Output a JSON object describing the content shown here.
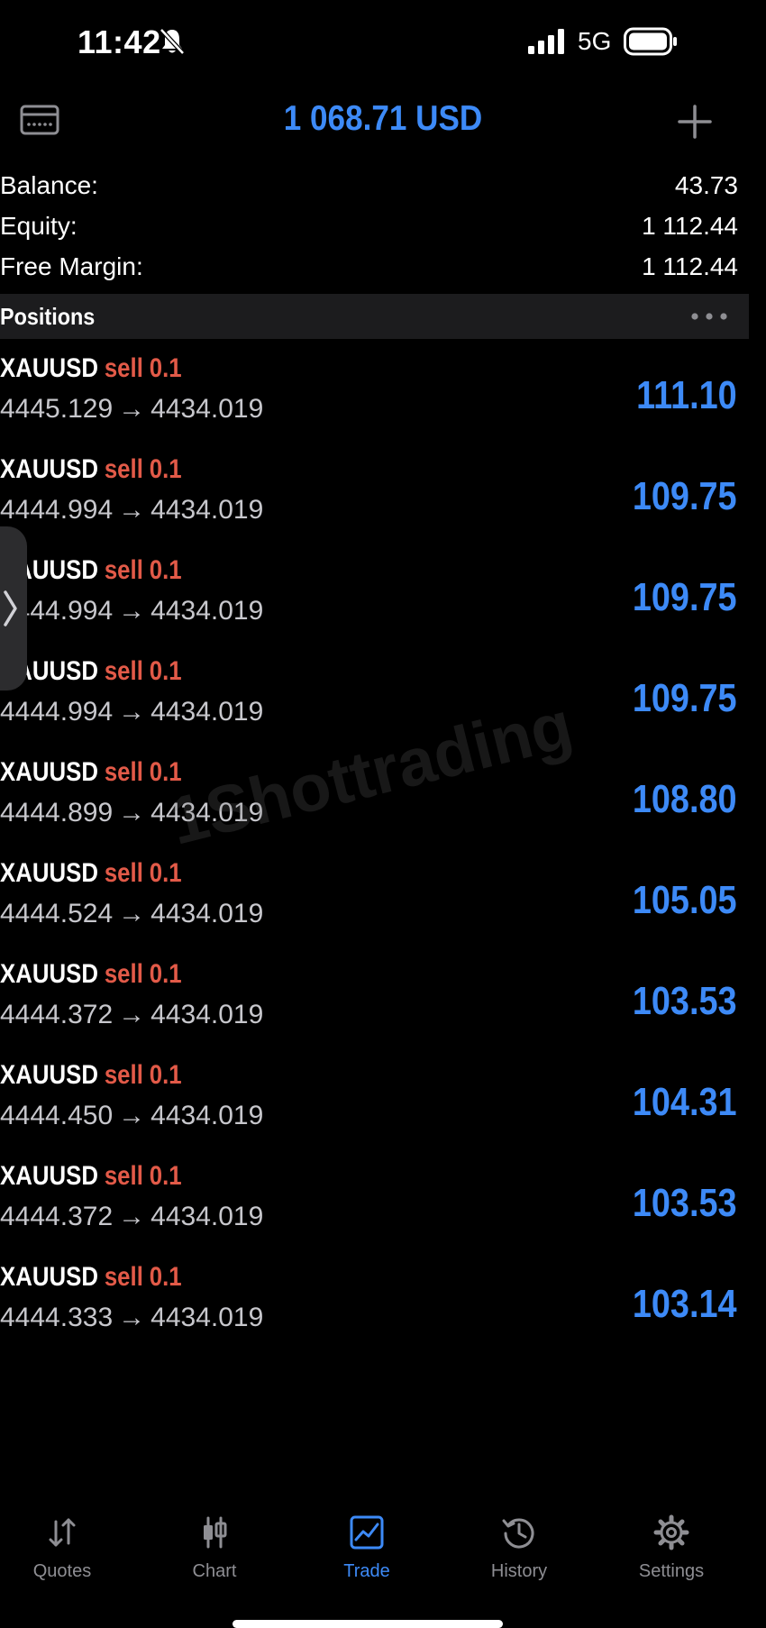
{
  "status_bar": {
    "time": "11:42",
    "network": "5G",
    "icons": [
      "bell-slash-icon",
      "signal-icon",
      "battery-icon"
    ]
  },
  "header": {
    "title": "1 068.71 USD",
    "left_icon": "wallet-icon",
    "right_icon": "plus-icon",
    "accent_color": "#3d8af7"
  },
  "summary": {
    "balance_label": "Balance:",
    "balance_value": "43.73",
    "equity_label": "Equity:",
    "equity_value": "1 112.44",
    "free_margin_label": "Free Margin:",
    "free_margin_value": "1 112.44"
  },
  "positions_section": {
    "title": "Positions",
    "menu_icon": "more-horizontal-icon"
  },
  "positions": [
    {
      "symbol": "XAUUSD",
      "side": "sell",
      "volume": "0.1",
      "open_price": "4445.129",
      "arrow": "→",
      "current_price": "4434.019",
      "profit": "111.10"
    },
    {
      "symbol": "XAUUSD",
      "side": "sell",
      "volume": "0.1",
      "open_price": "4444.994",
      "arrow": "→",
      "current_price": "4434.019",
      "profit": "109.75"
    },
    {
      "symbol": "XAUUSD",
      "side": "sell",
      "volume": "0.1",
      "open_price": "4444.994",
      "arrow": "→",
      "current_price": "4434.019",
      "profit": "109.75"
    },
    {
      "symbol": "XAUUSD",
      "side": "sell",
      "volume": "0.1",
      "open_price": "4444.994",
      "arrow": "→",
      "current_price": "4434.019",
      "profit": "109.75"
    },
    {
      "symbol": "XAUUSD",
      "side": "sell",
      "volume": "0.1",
      "open_price": "4444.899",
      "arrow": "→",
      "current_price": "4434.019",
      "profit": "108.80"
    },
    {
      "symbol": "XAUUSD",
      "side": "sell",
      "volume": "0.1",
      "open_price": "4444.524",
      "arrow": "→",
      "current_price": "4434.019",
      "profit": "105.05"
    },
    {
      "symbol": "XAUUSD",
      "side": "sell",
      "volume": "0.1",
      "open_price": "4444.372",
      "arrow": "→",
      "current_price": "4434.019",
      "profit": "103.53"
    },
    {
      "symbol": "XAUUSD",
      "side": "sell",
      "volume": "0.1",
      "open_price": "4444.450",
      "arrow": "→",
      "current_price": "4434.019",
      "profit": "104.31"
    },
    {
      "symbol": "XAUUSD",
      "side": "sell",
      "volume": "0.1",
      "open_price": "4444.372",
      "arrow": "→",
      "current_price": "4434.019",
      "profit": "103.53"
    },
    {
      "symbol": "XAUUSD",
      "side": "sell",
      "volume": "0.1",
      "open_price": "4444.333",
      "arrow": "→",
      "current_price": "4434.019",
      "profit": "103.14"
    }
  ],
  "watermark": "1Shottrading",
  "drawer_handle_icon": "chevron-right-icon",
  "colors": {
    "sell": "#e25a48",
    "profit": "#3d8af7",
    "tab_inactive": "#8e8e93",
    "background": "#000000"
  },
  "tab_bar": {
    "tabs": [
      {
        "label": "Quotes",
        "icon": "quotes-arrows-icon",
        "active": false
      },
      {
        "label": "Chart",
        "icon": "candlestick-chart-icon",
        "active": false
      },
      {
        "label": "Trade",
        "icon": "trade-chart-icon",
        "active": true
      },
      {
        "label": "History",
        "icon": "history-clock-icon",
        "active": false
      },
      {
        "label": "Settings",
        "icon": "gear-icon",
        "active": false
      }
    ]
  }
}
